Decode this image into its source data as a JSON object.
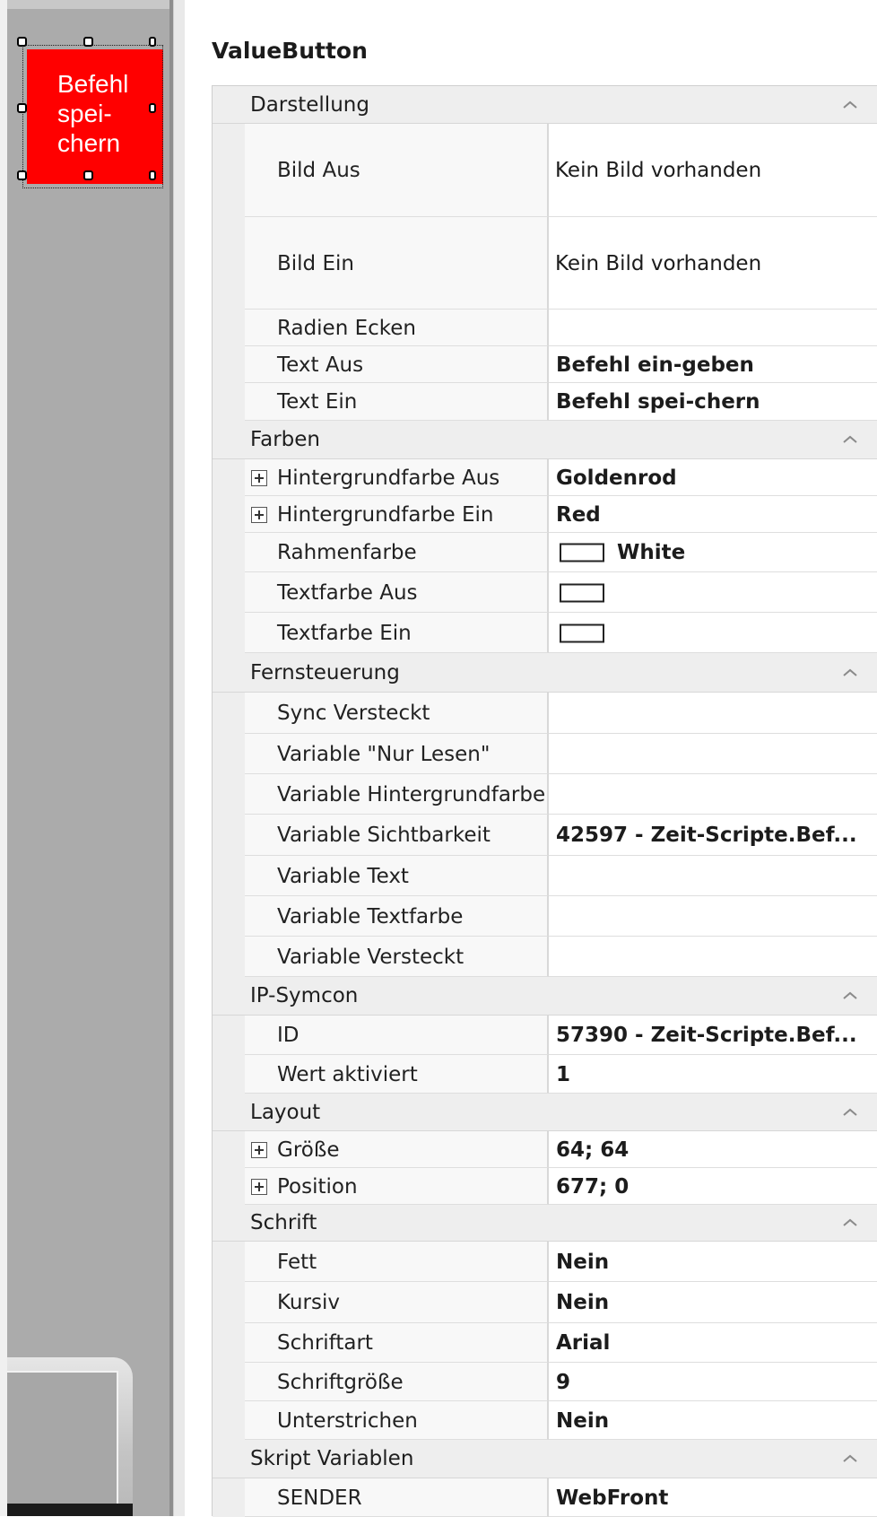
{
  "canvas": {
    "button_text_lines": [
      "Befehl",
      "spei-",
      "chern"
    ],
    "button_color": "#ff0000"
  },
  "panel": {
    "title": "ValueButton"
  },
  "colors": {
    "category_bg": "#eeeeee",
    "value_bg": "#ffffff",
    "canvas_bg": "#ababab"
  },
  "categories": {
    "darstellung": {
      "label": "Darstellung",
      "rows": {
        "bild_aus": {
          "name": "Bild Aus",
          "value": "Kein Bild vorhanden"
        },
        "bild_ein": {
          "name": "Bild Ein",
          "value": "Kein Bild vorhanden"
        },
        "radien_ecken": {
          "name": "Radien Ecken",
          "value": ""
        },
        "text_aus": {
          "name": "Text Aus",
          "value": "Befehl ein-geben"
        },
        "text_ein": {
          "name": "Text Ein",
          "value": "Befehl spei-chern"
        }
      }
    },
    "farben": {
      "label": "Farben",
      "rows": {
        "hintergrund_aus": {
          "name": "Hintergrundfarbe Aus",
          "value": "Goldenrod"
        },
        "hintergrund_ein": {
          "name": "Hintergrundfarbe Ein",
          "value": "Red"
        },
        "rahmenfarbe": {
          "name": "Rahmenfarbe",
          "value": "White"
        },
        "textfarbe_aus": {
          "name": "Textfarbe Aus",
          "value": ""
        },
        "textfarbe_ein": {
          "name": "Textfarbe Ein",
          "value": ""
        }
      }
    },
    "fernsteuerung": {
      "label": "Fernsteuerung",
      "rows": {
        "sync_versteckt": {
          "name": "Sync Versteckt",
          "value": ""
        },
        "nur_lesen": {
          "name": "Variable \"Nur Lesen\"",
          "value": ""
        },
        "var_hintergrund": {
          "name": "Variable Hintergrundfarbe",
          "value": ""
        },
        "var_sichtbarkeit": {
          "name": "Variable Sichtbarkeit",
          "value": "42597 - Zeit-Scripte.Bef..."
        },
        "var_text": {
          "name": "Variable Text",
          "value": ""
        },
        "var_textfarbe": {
          "name": "Variable Textfarbe",
          "value": ""
        },
        "var_versteckt": {
          "name": "Variable Versteckt",
          "value": ""
        }
      }
    },
    "ipsymcon": {
      "label": "IP-Symcon",
      "rows": {
        "id": {
          "name": "ID",
          "value": "57390 - Zeit-Scripte.Bef..."
        },
        "wert_aktiviert": {
          "name": "Wert aktiviert",
          "value": "1"
        }
      }
    },
    "layout": {
      "label": "Layout",
      "rows": {
        "groesse": {
          "name": "Größe",
          "value": "64; 64"
        },
        "position": {
          "name": "Position",
          "value": "677; 0"
        }
      }
    },
    "schrift": {
      "label": "Schrift",
      "rows": {
        "fett": {
          "name": "Fett",
          "value": "Nein"
        },
        "kursiv": {
          "name": "Kursiv",
          "value": "Nein"
        },
        "schriftart": {
          "name": "Schriftart",
          "value": "Arial"
        },
        "schriftgroesse": {
          "name": "Schriftgröße",
          "value": "9"
        },
        "unterstrichen": {
          "name": "Unterstrichen",
          "value": "Nein"
        }
      }
    },
    "skript": {
      "label": "Skript Variablen",
      "rows": {
        "sender": {
          "name": "SENDER",
          "value": "WebFront"
        }
      }
    }
  }
}
